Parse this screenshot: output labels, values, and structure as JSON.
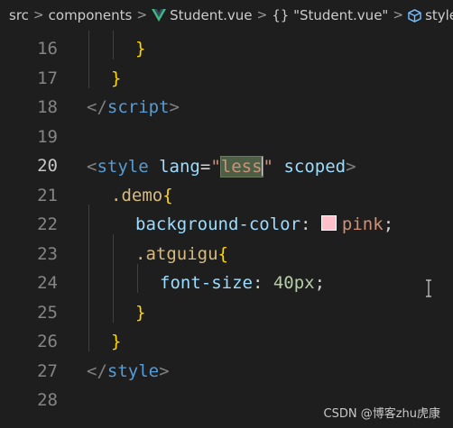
{
  "breadcrumb": {
    "items": [
      "src",
      "components",
      "Student.vue",
      "{} \"Student.vue\"",
      "style"
    ],
    "separator": ">"
  },
  "editor": {
    "active_line": "20",
    "lines": [
      {
        "num": "16"
      },
      {
        "num": "17"
      },
      {
        "num": "18"
      },
      {
        "num": "19"
      },
      {
        "num": "20"
      },
      {
        "num": "21"
      },
      {
        "num": "22"
      },
      {
        "num": "23"
      },
      {
        "num": "24"
      },
      {
        "num": "25"
      },
      {
        "num": "26"
      },
      {
        "num": "27"
      },
      {
        "num": "28"
      }
    ],
    "code": {
      "l16_brace": "}",
      "l17_brace": "}",
      "l18_open": "</",
      "l18_tag": "script",
      "l18_close": ">",
      "l20_open": "<",
      "l20_tag": "style",
      "l20_attr": "lang",
      "l20_eq": "=",
      "l20_q1": "\"",
      "l20_val": "less",
      "l20_q2": "\"",
      "l20_attr2": "scoped",
      "l20_close": ">",
      "l21_sel": ".demo",
      "l21_brace": "{",
      "l22_prop": "background-color",
      "l22_colon": ": ",
      "l22_val": "pink",
      "l22_semi": ";",
      "l23_sel": ".atguigu",
      "l23_brace": "{",
      "l24_prop": "font-size",
      "l24_colon": ": ",
      "l24_num": "40px",
      "l24_semi": ";",
      "l25_brace": "}",
      "l26_brace": "}",
      "l27_open": "</",
      "l27_tag": "style",
      "l27_close": ">"
    },
    "swatch_color": "#ffc0cb"
  },
  "watermark": "CSDN @博客zhu虎康",
  "colors": {
    "background": "#1e1e1e",
    "tag": "#569cd6",
    "attribute": "#9cdcfe",
    "string": "#ce9178",
    "selector": "#d7ba7d",
    "number": "#b5cea8",
    "brace": "#ffd700"
  }
}
